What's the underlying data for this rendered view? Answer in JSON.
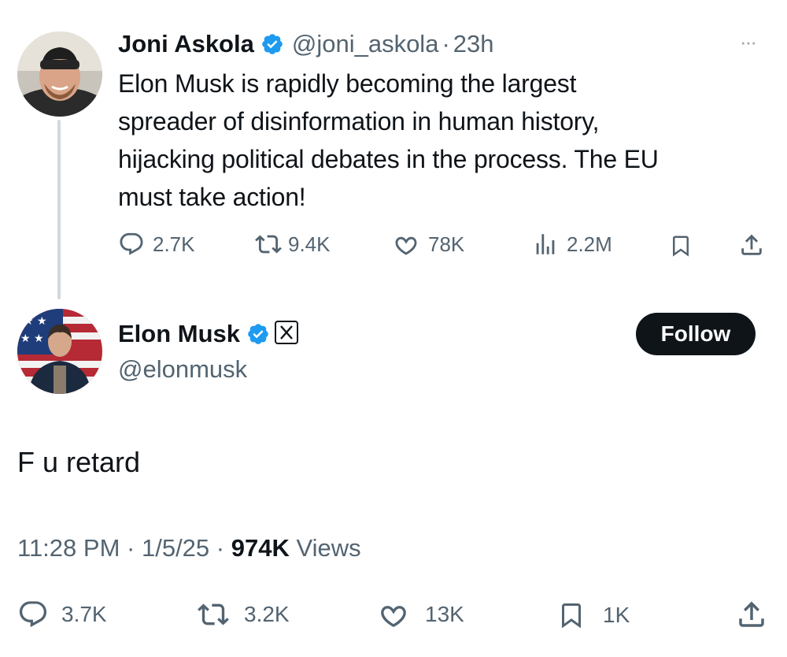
{
  "quoted_tweet": {
    "author_name": "Joni Askola",
    "author_handle": "@joni_askola",
    "separator": "·",
    "time_ago": "23h",
    "more_label": "···",
    "text": "Elon Musk is rapidly becoming the largest spreader of disinformation in human history, hijacking political debates in the process. The EU must take action!",
    "text_lines": [
      "Elon Musk is rapidly becoming the largest",
      "spreader of disinformation in human history,",
      "hijacking political debates in the process. The EU",
      "must take action!"
    ],
    "stats": {
      "replies": "2.7K",
      "reposts": "9.4K",
      "likes": "78K",
      "views": "2.2M"
    },
    "icons": [
      "reply-icon",
      "repost-icon",
      "like-icon",
      "views-icon",
      "bookmark-icon",
      "share-icon",
      "verified-badge-icon"
    ]
  },
  "main_tweet": {
    "author_name": "Elon Musk",
    "author_handle": "@elonmusk",
    "follow_label": "Follow",
    "text": "F u retard",
    "time": "11:28 PM",
    "separator": "·",
    "date": "1/5/25",
    "views_count": "974K",
    "views_label": "Views",
    "stats": {
      "replies": "3.7K",
      "reposts": "3.2K",
      "likes": "13K",
      "bookmarks": "1K"
    },
    "icons": [
      "verified-badge-icon",
      "x-affiliate-icon",
      "reply-icon",
      "repost-icon",
      "like-icon",
      "bookmark-icon",
      "share-icon"
    ]
  },
  "colors": {
    "text_primary": "#0f1419",
    "text_secondary": "#536471",
    "verified_blue": "#1d9bf0",
    "follow_button_bg": "#0f1419",
    "thread_line": "#cfd9de"
  }
}
